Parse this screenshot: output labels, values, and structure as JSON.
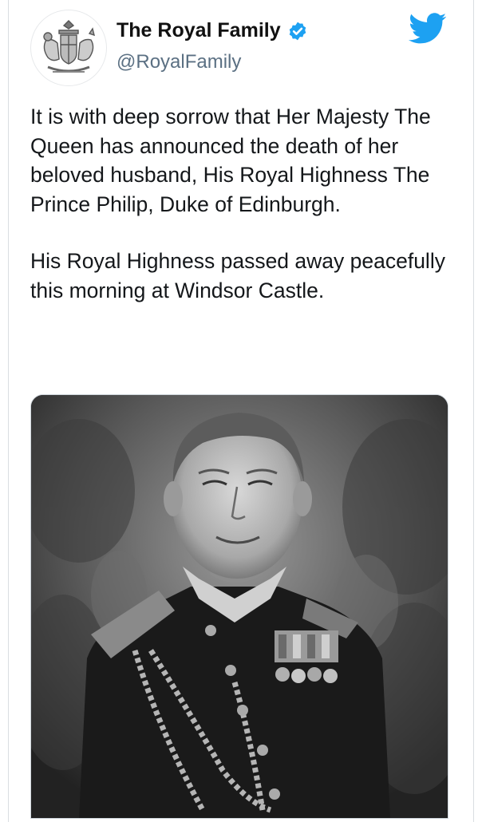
{
  "account": {
    "display_name": "The Royal Family",
    "handle": "@RoyalFamily",
    "verified": true,
    "avatar_icon": "royal-coat-of-arms-icon"
  },
  "brand": {
    "icon": "twitter-bird-icon",
    "accent": "#1da1f2"
  },
  "tweet": {
    "paragraphs": [
      "It is with deep sorrow that Her Majesty The Queen has announced the death of her beloved husband, His Royal Highness The Prince Philip, Duke of Edinburgh.",
      "His Royal Highness passed away peacefully this morning at Windsor Castle."
    ]
  },
  "media": {
    "kind": "black-and-white portrait photograph",
    "icon": "portrait-photo"
  }
}
